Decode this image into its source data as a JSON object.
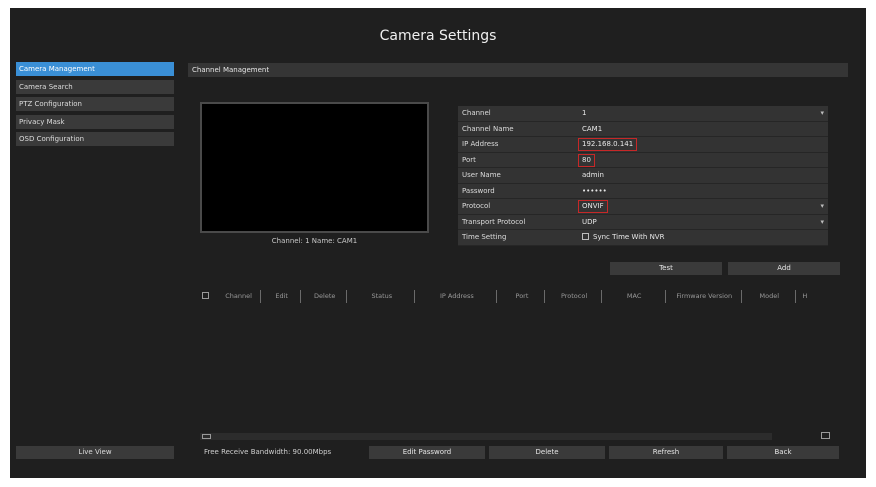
{
  "window": {
    "title": "Camera Settings"
  },
  "sidebar": {
    "items": [
      {
        "label": "Camera Management",
        "active": true
      },
      {
        "label": "Camera Search"
      },
      {
        "label": "PTZ Configuration"
      },
      {
        "label": "Privacy Mask"
      },
      {
        "label": "OSD Configuration"
      }
    ],
    "live_view": "Live View"
  },
  "section": {
    "title": "Channel Management"
  },
  "preview": {
    "caption": "Channel: 1 Name: CAM1"
  },
  "form": {
    "channel": {
      "label": "Channel",
      "value": "1"
    },
    "channel_name": {
      "label": "Channel Name",
      "value": "CAM1"
    },
    "ip_address": {
      "label": "IP Address",
      "value": "192.168.0.141"
    },
    "port": {
      "label": "Port",
      "value": "80"
    },
    "user_name": {
      "label": "User Name",
      "value": "admin"
    },
    "password": {
      "label": "Password",
      "value": "••••••"
    },
    "protocol": {
      "label": "Protocol",
      "value": "ONVIF"
    },
    "transport": {
      "label": "Transport Protocol",
      "value": "UDP"
    },
    "time_setting": {
      "label": "Time Setting",
      "value": "Sync Time With NVR"
    }
  },
  "buttons": {
    "test": "Test",
    "add": "Add",
    "edit_password": "Edit Password",
    "delete": "Delete",
    "refresh": "Refresh",
    "back": "Back"
  },
  "table": {
    "columns": [
      "Channel",
      "Edit",
      "Delete",
      "Status",
      "IP Address",
      "Port",
      "Protocol",
      "MAC",
      "Firmware Version",
      "Model",
      "H"
    ]
  },
  "status": {
    "bandwidth": "Free Receive Bandwidth: 90.00Mbps"
  },
  "colors": {
    "accent": "#3a8fd6",
    "highlight": "#c62828",
    "background": "#1f1f1f"
  }
}
